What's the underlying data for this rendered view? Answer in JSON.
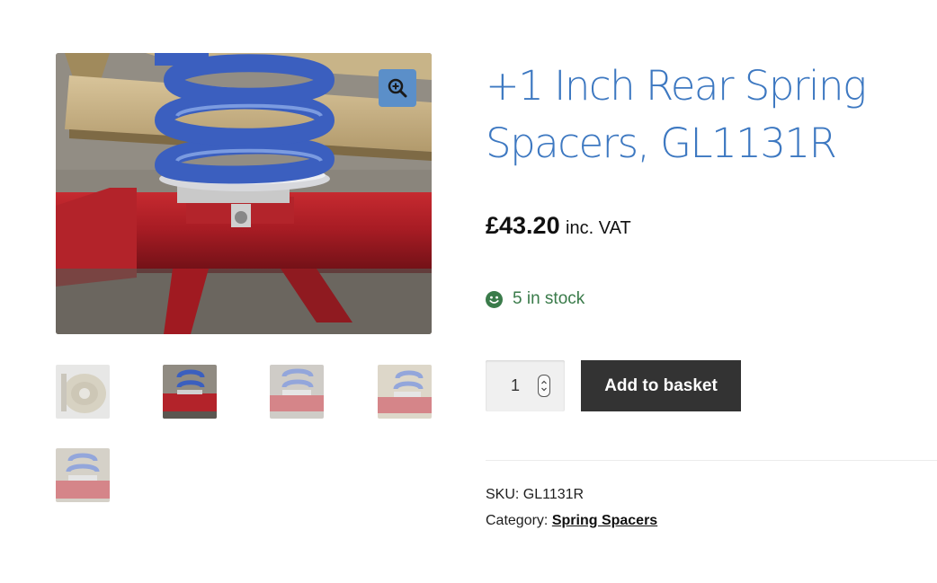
{
  "product": {
    "title": "+1 Inch Rear Spring Spacers, GL1131R",
    "price": "£43.20",
    "price_suffix": "inc. VAT",
    "stock": "5 in stock",
    "quantity": "1",
    "add_to_basket_label": "Add to basket",
    "sku_label": "SKU:",
    "sku": "GL1131R",
    "category_label": "Category:",
    "category": "Spring Spacers"
  },
  "gallery": {
    "main_image": "coil-spring-on-red-axle-photo",
    "zoom_icon": "zoom-in-icon",
    "thumbnails": [
      {
        "image": "spacer-part-photo",
        "active": false
      },
      {
        "image": "coil-spring-on-red-axle-photo",
        "active": true
      },
      {
        "image": "coil-spring-on-red-axle-photo",
        "active": false
      },
      {
        "image": "coil-spring-on-red-axle-photo",
        "active": false
      },
      {
        "image": "coil-spring-on-red-axle-photo",
        "active": false
      }
    ]
  },
  "colors": {
    "title": "#3d78c1",
    "stock": "#3a7b4a",
    "button_bg": "#333333",
    "zoom_bg": "#5b8fc9",
    "spring": "#3b5fbf",
    "axle": "#b01e26"
  }
}
